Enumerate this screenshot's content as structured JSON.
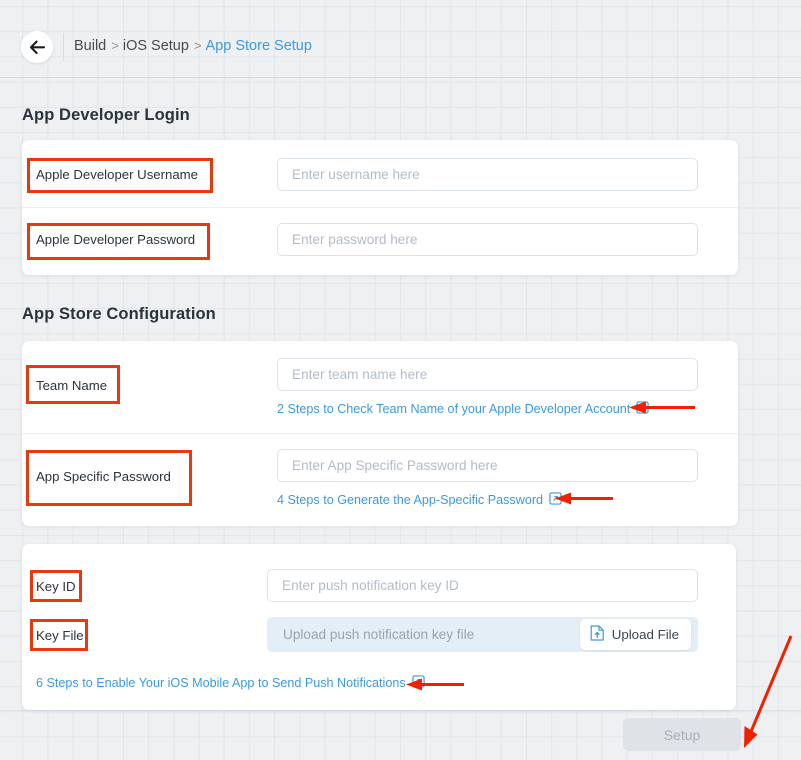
{
  "header": {
    "back_icon": "back-arrow-icon",
    "breadcrumb": [
      {
        "label": "Build",
        "active": false
      },
      {
        "label": "iOS Setup",
        "active": false
      },
      {
        "label": "App Store Setup",
        "active": true
      }
    ],
    "separator": ">"
  },
  "sections": {
    "login": {
      "title": "App Developer Login",
      "fields": [
        {
          "label": "Apple Developer Username",
          "placeholder": "Enter username here"
        },
        {
          "label": "Apple Developer Password",
          "placeholder": "Enter password here"
        }
      ]
    },
    "config": {
      "title": "App Store Configuration",
      "fields": [
        {
          "label": "Team Name",
          "placeholder": "Enter team name here",
          "help": "2 Steps to Check Team Name of your Apple Developer Account",
          "help_icon": "external-link-icon"
        },
        {
          "label": "App Specific Password",
          "placeholder": "Enter App Specific Password here",
          "help": "4 Steps to Generate the App-Specific Password",
          "help_icon": "external-link-icon"
        }
      ]
    },
    "push": {
      "fields": [
        {
          "label": "Key ID",
          "placeholder": "Enter push notification key ID"
        },
        {
          "label": "Key File",
          "placeholder": "Upload push notification key file"
        }
      ],
      "upload_button": {
        "label": "Upload File",
        "icon": "file-upload-icon"
      },
      "help": "6 Steps to Enable Your iOS Mobile App to Send Push Notifications",
      "help_icon": "external-link-icon"
    }
  },
  "footer": {
    "setup_label": "Setup"
  },
  "annotations": {
    "highlight_color": "#e8380d",
    "arrow_color": "#ee2200"
  },
  "colors": {
    "link": "#3b9ae1",
    "page_background": "#eef0f2",
    "card_background": "#ffffff",
    "upload_row_background": "#e4eef6",
    "disabled_button": "#dfe3e8"
  }
}
